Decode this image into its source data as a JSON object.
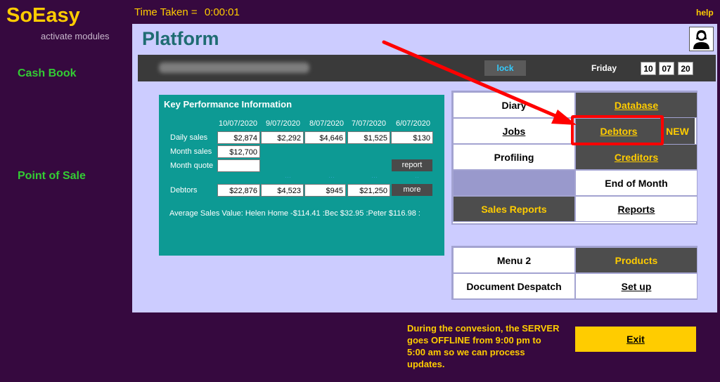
{
  "app": {
    "brand": "SoEasy",
    "brand_sub": "activate modules",
    "timer_label": "Time Taken =",
    "timer_value": "0:00:01",
    "help": "help"
  },
  "sidebar": {
    "items": [
      {
        "label": "Cash Book"
      },
      {
        "label": "Point of Sale"
      }
    ]
  },
  "platform": {
    "title": "Platform",
    "user_icon": "user-avatar-icon"
  },
  "header_bar": {
    "lock": "lock",
    "day": "Friday",
    "date": {
      "day": "10",
      "month": "07",
      "year": "20"
    }
  },
  "kpi": {
    "title": "Key Performance Information",
    "dates": [
      "10/07/2020",
      "9/07/2020",
      "8/07/2020",
      "7/07/2020",
      "6/07/2020"
    ],
    "daily_sales_label": "Daily sales",
    "daily_sales": [
      "$2,874",
      "$2,292",
      "$4,646",
      "$1,525",
      "$130"
    ],
    "month_sales_label": "Month sales",
    "month_sales": "$12,700",
    "month_quote_label": "Month quote",
    "month_quote": "",
    "report_btn": "report",
    "debtors_label": "Debtors",
    "debtors": [
      "$22,876",
      "$4,523",
      "$945",
      "$21,250"
    ],
    "more_btn": "more",
    "avg_sales": "Average Sales Value: Helen Home -$114.41 :Bec $32.95 :Peter $116.98 :"
  },
  "menu1": {
    "diary": "Diary",
    "database": "Database",
    "jobs": "Jobs",
    "debtors": "Debtors",
    "new_tag": "NEW",
    "profiling": "Profiling",
    "creditors": "Creditors",
    "end_of_month": "End of Month",
    "sales_reports": "Sales Reports",
    "reports": "Reports"
  },
  "menu2": {
    "menu2": "Menu 2",
    "products": "Products",
    "document_despatch": "Document Despatch",
    "setup": "Set up"
  },
  "footer": {
    "notice": "During the convesion, the SERVER goes OFFLINE from 9:00 pm to 5:00 am so we can process updates.",
    "exit": "Exit"
  },
  "colors": {
    "background": "#36093f",
    "panel": "#ccccff",
    "accent_yellow": "#ffcc00",
    "kpi_teal": "#0d9a94",
    "highlight_red": "#ff0000"
  }
}
